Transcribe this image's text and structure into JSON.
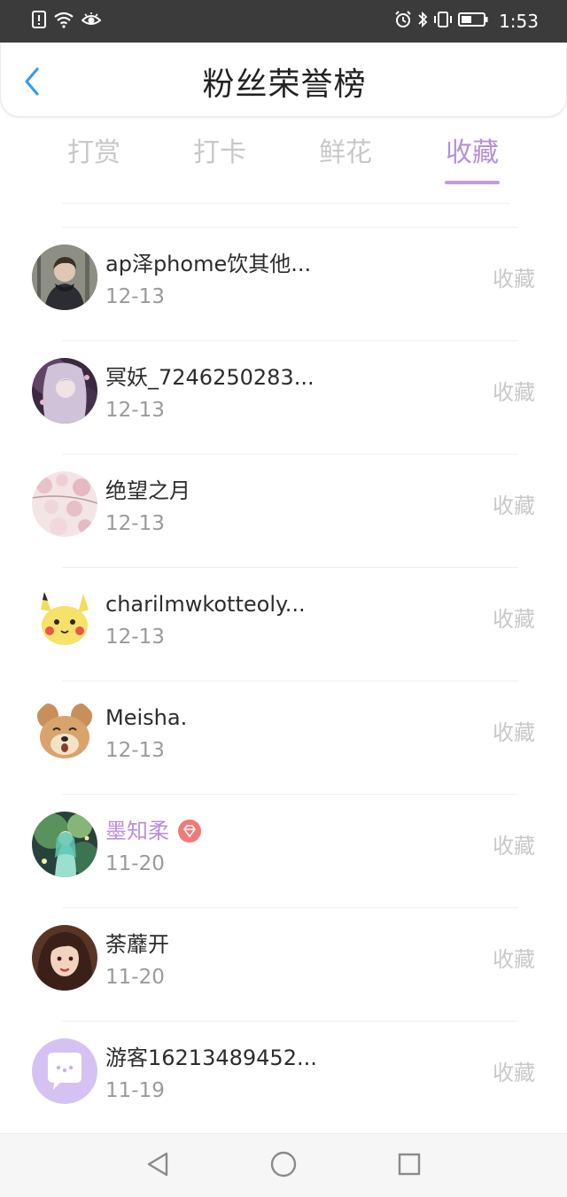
{
  "status_bar": {
    "time": "1:53",
    "left_icons": [
      "sim-alert-icon",
      "wifi-icon",
      "eye-icon"
    ],
    "right_icons": [
      "alarm-icon",
      "bluetooth-icon",
      "vibrate-icon",
      "battery-icon"
    ]
  },
  "header": {
    "title": "粉丝荣誉榜",
    "back_icon": "chevron-left-icon"
  },
  "tabs": [
    {
      "label": "打赏",
      "active": false
    },
    {
      "label": "打卡",
      "active": false
    },
    {
      "label": "鲜花",
      "active": false
    },
    {
      "label": "收藏",
      "active": true
    }
  ],
  "accent_color": "#b690d8",
  "fans": [
    {
      "name": "ap泽phome饮其他...",
      "date": "12-13",
      "action": "收藏",
      "vip": false,
      "avatar": "photo-avatar-person"
    },
    {
      "name": "冥妖_7246250283...",
      "date": "12-13",
      "action": "收藏",
      "vip": false,
      "avatar": "anime-girl-avatar"
    },
    {
      "name": "绝望之月",
      "date": "12-13",
      "action": "收藏",
      "vip": false,
      "avatar": "blossom-avatar"
    },
    {
      "name": "charilmwkotteoly...",
      "date": "12-13",
      "action": "收藏",
      "vip": false,
      "avatar": "pikachu-avatar"
    },
    {
      "name": "Meisha.",
      "date": "12-13",
      "action": "收藏",
      "vip": false,
      "avatar": "chipmunk-avatar"
    },
    {
      "name": "墨知柔",
      "date": "11-20",
      "action": "收藏",
      "vip": true,
      "avatar": "forest-girl-avatar"
    },
    {
      "name": "荼蘼开",
      "date": "11-20",
      "action": "收藏",
      "vip": false,
      "avatar": "portrait-girl-avatar"
    },
    {
      "name": "游客16213489452...",
      "date": "11-19",
      "action": "收藏",
      "vip": false,
      "avatar": "guest-chat-avatar"
    }
  ],
  "nav_bar": {
    "icons": [
      "back-triangle-icon",
      "home-circle-icon",
      "recents-square-icon"
    ]
  }
}
